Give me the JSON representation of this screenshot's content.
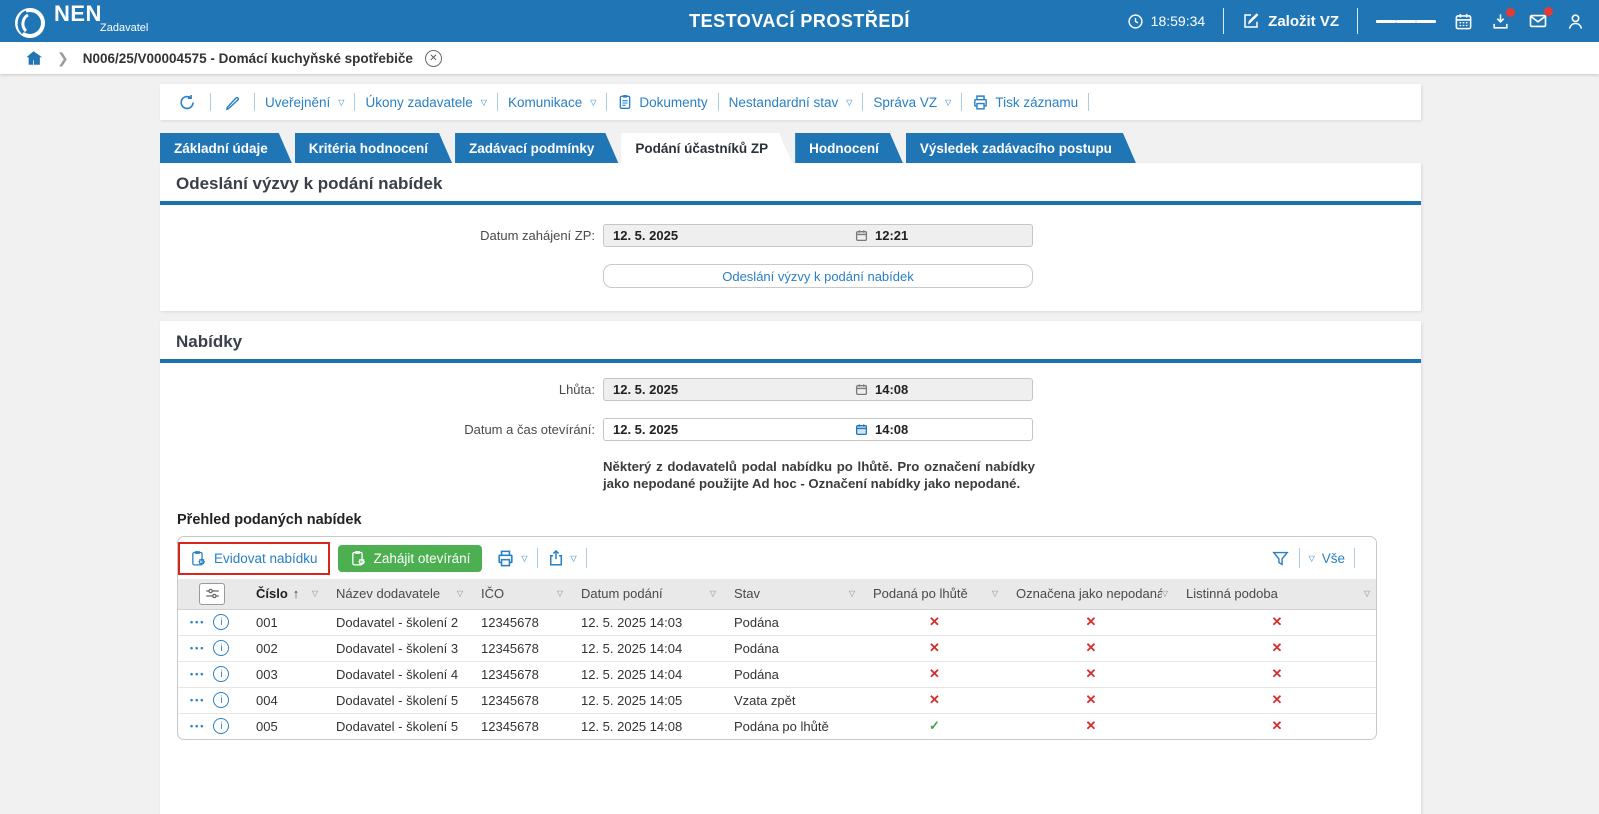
{
  "colors": {
    "topbar": "#2076b5",
    "link": "#2980c4",
    "section_rule": "#1d71ad",
    "green_button": "#4caf50",
    "red_cross": "#d32f2f",
    "green_check": "#3aa544",
    "highlight_box": "#d9261c",
    "page_bg": "#f1f1f1"
  },
  "icons": {
    "check": "✓",
    "cross": "✕",
    "sort_asc": "↑",
    "caret_down": "▽",
    "menu_dots": "•••",
    "info": "i",
    "close": "✕"
  },
  "topbar": {
    "brand": "NEN",
    "brand_sub": "Zadavatel",
    "title": "TESTOVACÍ PROSTŘEDÍ",
    "time": "18:59:34",
    "create_button": "Založit VZ"
  },
  "breadcrumb": {
    "item": "N006/25/V00004575 - Domácí kuchyňské spotřebiče"
  },
  "toolbar": {
    "items": [
      {
        "label": "Uveřejnění",
        "caret": true
      },
      {
        "label": "Úkony zadavatele",
        "caret": true
      },
      {
        "label": "Komunikace",
        "caret": true
      },
      {
        "label": "Dokumenty",
        "icon": "document"
      },
      {
        "label": "Nestandardní stav",
        "caret": true
      },
      {
        "label": "Správa VZ",
        "caret": true
      },
      {
        "label": "Tisk záznamu",
        "icon": "printer"
      }
    ]
  },
  "tabs": [
    {
      "label": "Základní údaje",
      "active": false
    },
    {
      "label": "Kritéria hodnocení",
      "active": false
    },
    {
      "label": "Zadávací podmínky",
      "active": false
    },
    {
      "label": "Podání účastníků ZP",
      "active": true
    },
    {
      "label": "Hodnocení",
      "active": false
    },
    {
      "label": "Výsledek zadávacího postupu",
      "active": false
    }
  ],
  "invitation": {
    "title": "Odeslání výzvy k podání nabídek",
    "field_label": "Datum zahájení ZP:",
    "date": "12. 5. 2025",
    "time": "12:21",
    "button": "Odeslání výzvy k podání nabídek"
  },
  "offers": {
    "title": "Nabídky",
    "deadline_label": "Lhůta:",
    "deadline_date": "12. 5. 2025",
    "deadline_time": "14:08",
    "opening_label": "Datum a čas otevírání:",
    "opening_date": "12. 5. 2025",
    "opening_time": "14:08",
    "warning": "Některý z dodavatelů podal nabídku po lhůtě. Pro označení nabídky jako nepodané použijte Ad hoc - Označení nabídky jako nepodané.",
    "table_title": "Přehled podaných nabídek"
  },
  "grid": {
    "buttons": {
      "register": "Evidovat nabídku",
      "open": "Zahájit otevírání",
      "filter_all": "Vše"
    },
    "columns": [
      {
        "label": "Číslo",
        "sorted": true
      },
      {
        "label": "Název dodavatele"
      },
      {
        "label": "IČO"
      },
      {
        "label": "Datum podání"
      },
      {
        "label": "Stav"
      },
      {
        "label": "Podaná po lhůtě"
      },
      {
        "label": "Označena jako nepodaná"
      },
      {
        "label": "Listinná podoba"
      }
    ],
    "rows": [
      {
        "cislo": "001",
        "dodavatel": "Dodavatel - školení 2",
        "ico": "12345678",
        "datum": "12. 5. 2025 14:03",
        "stav": "Podána",
        "po_lhute": false,
        "nepodana": false,
        "listinna": false
      },
      {
        "cislo": "002",
        "dodavatel": "Dodavatel - školení 3",
        "ico": "12345678",
        "datum": "12. 5. 2025 14:04",
        "stav": "Podána",
        "po_lhute": false,
        "nepodana": false,
        "listinna": false
      },
      {
        "cislo": "003",
        "dodavatel": "Dodavatel - školení 4",
        "ico": "12345678",
        "datum": "12. 5. 2025 14:04",
        "stav": "Podána",
        "po_lhute": false,
        "nepodana": false,
        "listinna": false
      },
      {
        "cislo": "004",
        "dodavatel": "Dodavatel - školení 5",
        "ico": "12345678",
        "datum": "12. 5. 2025 14:05",
        "stav": "Vzata zpět",
        "po_lhute": false,
        "nepodana": false,
        "listinna": false
      },
      {
        "cislo": "005",
        "dodavatel": "Dodavatel - školení 5",
        "ico": "12345678",
        "datum": "12. 5. 2025 14:08",
        "stav": "Podána po lhůtě",
        "po_lhute": true,
        "nepodana": false,
        "listinna": false
      }
    ]
  }
}
